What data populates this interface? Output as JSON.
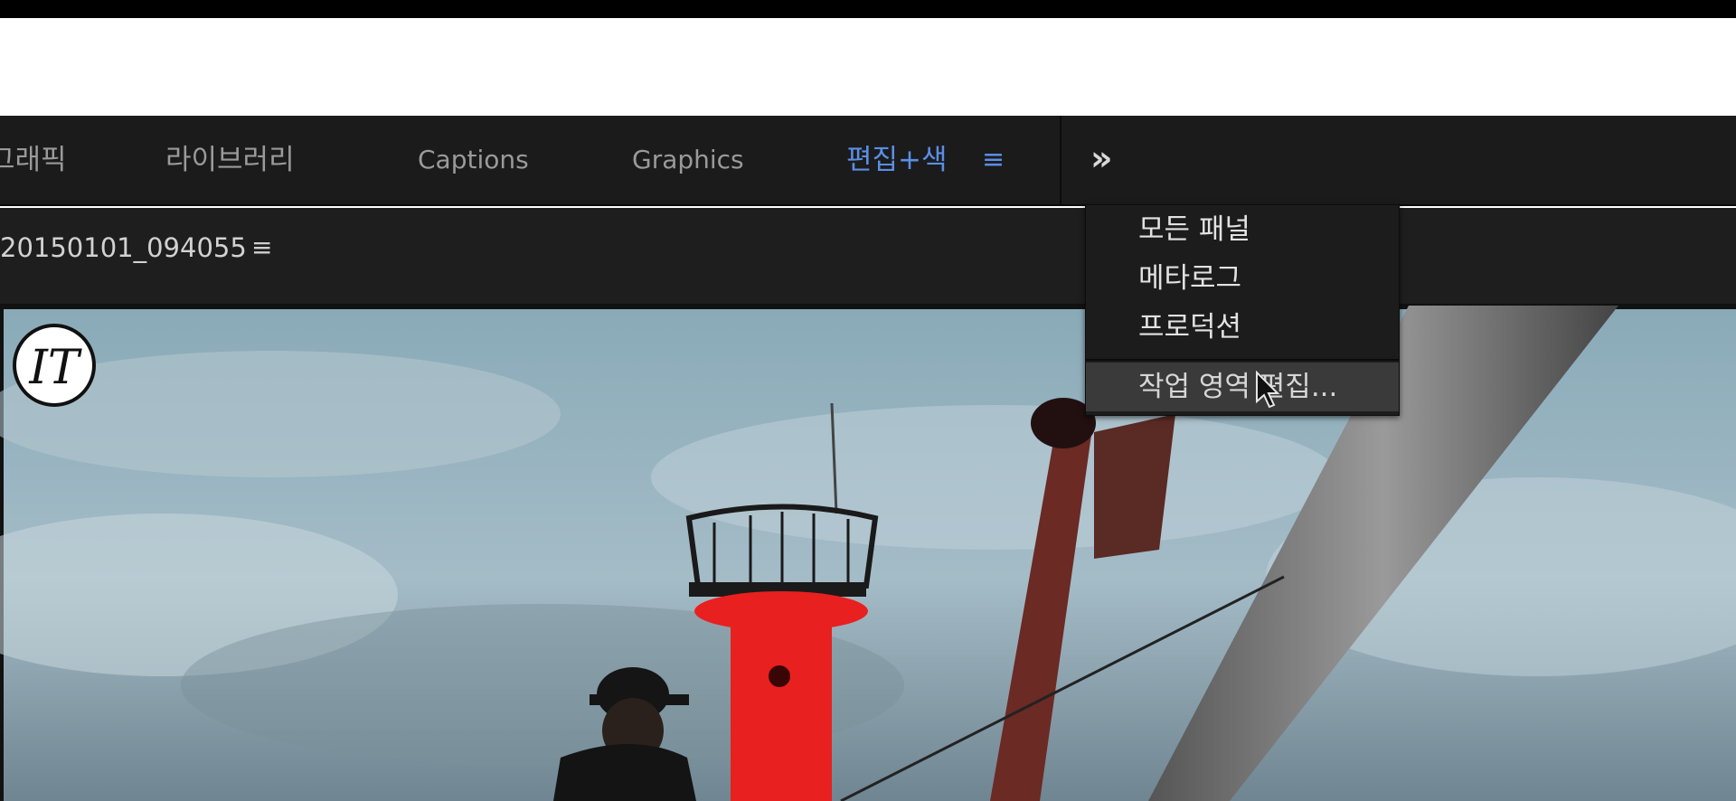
{
  "workspace_tabs": {
    "graphics_ko": "그래픽",
    "library": "라이브러리",
    "captions": "Captions",
    "graphics": "Graphics",
    "edit_color": "편집+색",
    "menu_glyph": "≡",
    "overflow_glyph": "»"
  },
  "panel": {
    "clip_name": "20150101_094055",
    "menu_glyph": "≡"
  },
  "dropdown": {
    "items": [
      "모든 패널",
      "메타로그",
      "프로덕션"
    ],
    "edit_workspaces": "작업 영역 편집..."
  },
  "viewer": {
    "logo_text": "IT"
  },
  "colors": {
    "accent": "#5b8ee6",
    "panel_bg": "#1b1b1b",
    "lighthouse_red": "#e8201f"
  }
}
